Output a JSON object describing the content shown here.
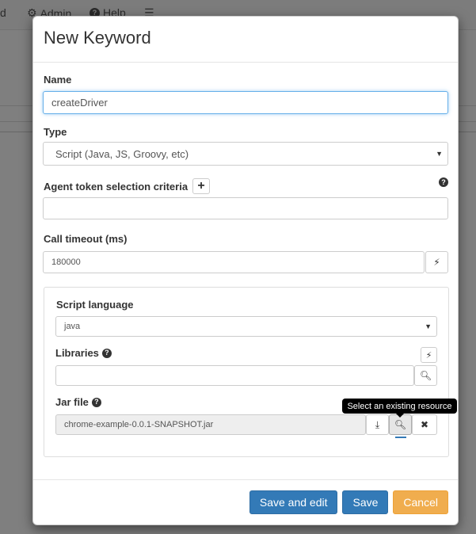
{
  "background": {
    "nav": [
      {
        "label": "d",
        "icon": ""
      },
      {
        "label": "Admin",
        "icon": "gear-icon"
      },
      {
        "label": "Help",
        "icon": "question-circle-icon"
      },
      {
        "label": "",
        "icon": "hamburger-menu-icon"
      }
    ]
  },
  "modal": {
    "title": "New Keyword",
    "name": {
      "label": "Name",
      "value": "createDriver"
    },
    "type": {
      "label": "Type",
      "value": "Script (Java, JS, Groovy, etc)"
    },
    "agent_token": {
      "label": "Agent token selection criteria",
      "value": ""
    },
    "call_timeout": {
      "label": "Call timeout (ms)",
      "value": "180000"
    },
    "script_language": {
      "label": "Script language",
      "value": "java"
    },
    "libraries": {
      "label": "Libraries",
      "value": ""
    },
    "jar_file": {
      "label": "Jar file",
      "value": "chrome-example-0.0.1-SNAPSHOT.jar"
    },
    "tooltip": "Select an existing resource",
    "buttons": {
      "save_and_edit": "Save and edit",
      "save": "Save",
      "cancel": "Cancel"
    },
    "colors": {
      "primary": "#337ab7",
      "warning": "#f0ad4e"
    }
  }
}
